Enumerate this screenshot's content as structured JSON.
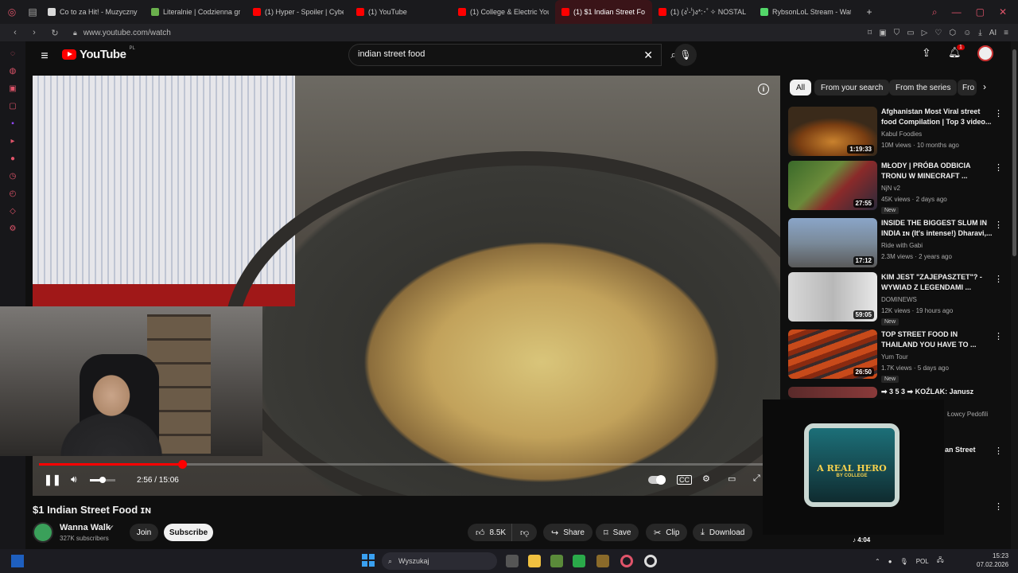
{
  "browser": {
    "tabs": [
      {
        "label": "Co to za Hit! - Muzyczny Q",
        "color": "#d9d9d9"
      },
      {
        "label": "Literalnie | Codzienna gra",
        "color": "#6ab04c"
      },
      {
        "label": "(1) Hyper - Spoiler | Cyber",
        "color": "#ff0000"
      },
      {
        "label": "(1) YouTube",
        "color": "#ff0000"
      },
      {
        "label": "(1) College & Electric Yout",
        "color": "#ff0000"
      },
      {
        "label": "(1) $1 Indian Street Fo",
        "color": "#ff0000",
        "active": true
      },
      {
        "label": "(1) (ง'̀-'́)ง*:･ﾟ✧ NOSTAL",
        "color": "#ff0000"
      },
      {
        "label": "RybsonLoL Stream - Watc",
        "color": "#53d769"
      }
    ],
    "url": "www.youtube.com/watch"
  },
  "youtube": {
    "logo_text": "YouTube",
    "logo_country": "PL",
    "search_value": "indian street food",
    "notification_count": "1",
    "chips": [
      "All",
      "From your search",
      "From the series",
      "Fro"
    ],
    "player": {
      "time_current": "2:56",
      "time_total": "15:06",
      "time_display": "2:56 / 15:06",
      "progress": 0.195,
      "volume": 0.5
    },
    "video": {
      "title": "$1 Indian Street Food ɪɴ",
      "channel": "Wanna Walk",
      "verified": "✔",
      "subscribers": "327K subscribers",
      "join_label": "Join",
      "subscribe_label": "Subscribe",
      "likes": "8.5K",
      "share_label": "Share",
      "save_label": "Save",
      "clip_label": "Clip",
      "download_label": "Download"
    },
    "recommendations": [
      {
        "title": "Afghanistan Most Viral street food Compilation | Top 3 video...",
        "channel": "Kabul Foodies",
        "meta": "10M views · 10 months ago",
        "duration": "1:19:33",
        "new": ""
      },
      {
        "title": "MŁODY | PRÓBA ODBICIA TRONU W MINECRAFT ...",
        "channel": "NjN v2",
        "meta": "45K views · 2 days ago",
        "duration": "27:55",
        "new": "New"
      },
      {
        "title": "INSIDE THE BIGGEST SLUM IN INDIA ɪɴ (It's intense!) Dharavi,...",
        "channel": "Ride with Gabi",
        "meta": "2.3M views · 2 years ago",
        "duration": "17:12",
        "new": ""
      },
      {
        "title": "KIM JEST \"ZAJEPASZTET\"? - WYWIAD Z LEGENDAMI ...",
        "channel": "DOMINEWS",
        "meta": "12K views · 19 hours ago",
        "duration": "59:05",
        "new": "New"
      },
      {
        "title": "TOP STREET FOOD IN THAILAND YOU HAVE TO ...",
        "channel": "Yum Tour",
        "meta": "1.7K views · 5 days ago",
        "duration": "26:50",
        "new": "New"
      },
      {
        "title": "➡ 3 5 3 ➡ KOŹLAK: Janusz",
        "channel": "Łowcy Pedofili",
        "meta": "",
        "duration": "",
        "new": ""
      }
    ],
    "partial_rec_title": "an Street",
    "mini_player": {
      "title": "A REAL HERO",
      "subtitle": "BY COLLEGE",
      "duration": "4:04"
    }
  },
  "taskbar": {
    "search_placeholder": "Wyszukaj",
    "language": "POL",
    "time": "15:23",
    "date": "07.02.2026"
  }
}
